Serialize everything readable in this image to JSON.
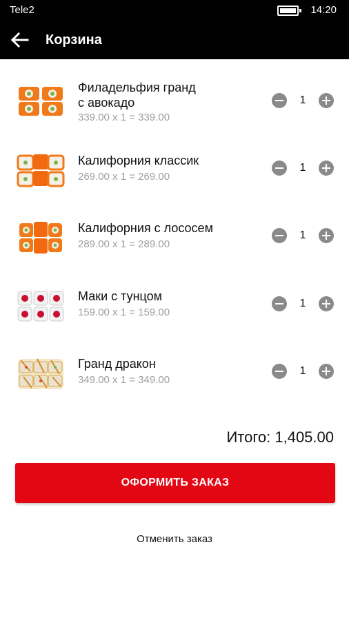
{
  "status_bar": {
    "carrier": "Tele2",
    "time": "14:20"
  },
  "app_bar": {
    "title": "Корзина",
    "back_icon": "arrow-left-icon"
  },
  "cart": {
    "items": [
      {
        "name_line1": "Филадельфия гранд",
        "name_line2": "с авокадо",
        "price_line": "339.00 x 1 = 339.00",
        "quantity": "1"
      },
      {
        "name_line1": "Калифорния классик",
        "name_line2": "",
        "price_line": "269.00 x 1 = 269.00",
        "quantity": "1"
      },
      {
        "name_line1": "Калифорния с лососем",
        "name_line2": "",
        "price_line": "289.00 x 1 = 289.00",
        "quantity": "1"
      },
      {
        "name_line1": "Маки с тунцом",
        "name_line2": "",
        "price_line": "159.00 x 1 = 159.00",
        "quantity": "1"
      },
      {
        "name_line1": "Гранд дракон",
        "name_line2": "",
        "price_line": "349.00 x 1 = 349.00",
        "quantity": "1"
      }
    ],
    "total_label": "Итого: 1,405.00",
    "order_button": "ОФОРМИТЬ ЗАКАЗ",
    "cancel_link": "Отменить заказ"
  },
  "colors": {
    "accent": "#e30613",
    "bar": "#000000",
    "stepper": "#8a8a8a",
    "price": "#9e9e9e"
  }
}
